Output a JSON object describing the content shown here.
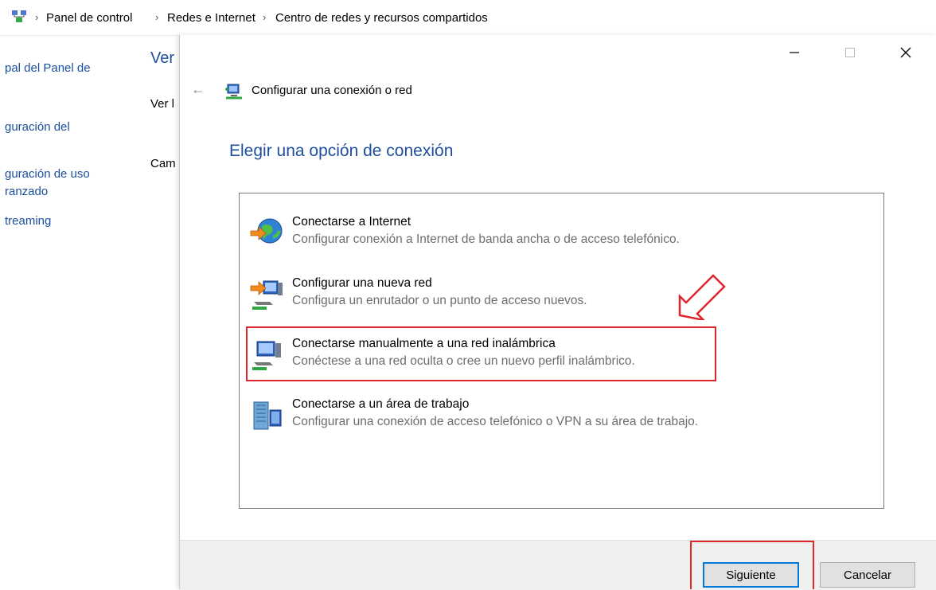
{
  "breadcrumb": {
    "items": [
      "Panel de control",
      "Redes e Internet",
      "Centro de redes y recursos compartidos"
    ],
    "separator": "›"
  },
  "background": {
    "left_links": [
      "pal del Panel de",
      "guración del",
      "guración de uso",
      "ranzado",
      "treaming"
    ],
    "heading": "Ver",
    "text1": "Ver l",
    "text2": "Cam"
  },
  "dialog": {
    "title": "Configurar una conexión o red",
    "back_symbol": "←",
    "instruction": "Elegir una opción de conexión",
    "options": [
      {
        "title": "Conectarse a Internet",
        "desc": "Configurar conexión a Internet de banda ancha o de acceso telefónico.",
        "icon": "globe-internet-icon"
      },
      {
        "title": "Configurar una nueva red",
        "desc": "Configura un enrutador o un punto de acceso nuevos.",
        "icon": "new-network-icon"
      },
      {
        "title": "Conectarse manualmente a una red inalámbrica",
        "desc": "Conéctese a una red oculta o cree un nuevo perfil inalámbrico.",
        "icon": "wireless-network-icon"
      },
      {
        "title": "Conectarse a un área de trabajo",
        "desc": "Configurar una conexión de acceso telefónico o VPN a su área de trabajo.",
        "icon": "workplace-icon"
      }
    ],
    "buttons": {
      "next": "Siguiente",
      "cancel": "Cancelar"
    }
  },
  "colors": {
    "link_blue": "#1e4e9e",
    "highlight_red": "#e0252c",
    "focus_blue": "#0078d7"
  }
}
